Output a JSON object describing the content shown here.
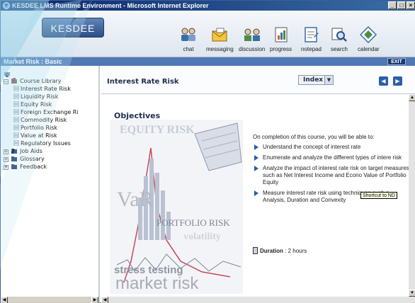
{
  "window": {
    "title": "KESDEE LMS Runtime Environment - Microsoft Internet Explorer",
    "controls": [
      "_",
      "□",
      "×"
    ]
  },
  "banner": {
    "logo_text": "KESDEE",
    "tools": [
      {
        "label": "chat",
        "icon": "chat-icon"
      },
      {
        "label": "messaging",
        "icon": "messaging-icon"
      },
      {
        "label": "discussion",
        "icon": "discussion-icon"
      },
      {
        "label": "progress",
        "icon": "progress-icon"
      },
      {
        "label": "notepad",
        "icon": "notepad-icon"
      },
      {
        "label": "search",
        "icon": "search-icon"
      },
      {
        "label": "calendar",
        "icon": "calendar-icon"
      }
    ]
  },
  "section": {
    "title": "Market Risk : Basic",
    "exit_label": "EXIT"
  },
  "tree": {
    "root": "Course Library",
    "items": [
      "Interest Rate Risk",
      "Liquidity Risk",
      "Equity Risk",
      "Foreign Exchange Ri",
      "Commodity Risk",
      "Portfolio Risk",
      "Value at Risk",
      "Regulatory Issues"
    ],
    "groups": [
      "Job Aids",
      "Glossary",
      "Feedback"
    ]
  },
  "content": {
    "page_title": "Interest Rate Risk",
    "index_label": "Index",
    "objectives_title": "Objectives",
    "intro": "On completion of this course, you will be able to:",
    "bullets": [
      "Understand the concept of interest rate",
      "Enumerate and analyze the different types of intere risk",
      "Analyze the impact of interest rate risk on target measures such as Net Interest Income and Econo Value of Portfolio Equity",
      "Measure interest rate risk using techniques such a Analysis, Duration and Convexity"
    ],
    "duration_label": "Duration",
    "duration_value": ": 2 hours",
    "tooltip": "Shortcut to ND"
  },
  "collage": {
    "words": [
      "EQUITY RISK",
      "VaR",
      "PORTFOLIO RISK",
      "volatility",
      "stress testing",
      "market risk"
    ]
  }
}
